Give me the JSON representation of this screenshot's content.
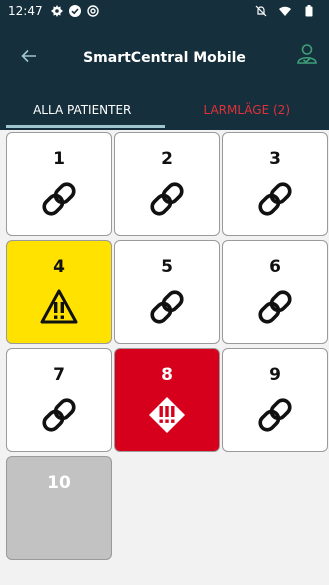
{
  "status_bar": {
    "time": "12:47",
    "left_icons": [
      "settings-icon",
      "check-circle-icon",
      "at-sign-icon"
    ],
    "right_icons": [
      "mute-icon",
      "wifi-icon",
      "battery-icon"
    ]
  },
  "app_bar": {
    "title": "SmartCentral Mobile",
    "back_icon": "arrow-left-icon",
    "profile_icon": "user-badge-icon"
  },
  "tabs": [
    {
      "label": "ALLA PATIENTER",
      "active": true
    },
    {
      "label": "LARMLÄGE (2)",
      "active": false
    }
  ],
  "patients": [
    {
      "number": "1",
      "state": "connected",
      "icon": "link-icon"
    },
    {
      "number": "2",
      "state": "connected",
      "icon": "link-icon"
    },
    {
      "number": "3",
      "state": "connected",
      "icon": "link-icon"
    },
    {
      "number": "4",
      "state": "warning",
      "icon": "warning-triangle-icon"
    },
    {
      "number": "5",
      "state": "connected",
      "icon": "link-icon"
    },
    {
      "number": "6",
      "state": "connected",
      "icon": "link-icon"
    },
    {
      "number": "7",
      "state": "connected",
      "icon": "link-icon"
    },
    {
      "number": "8",
      "state": "critical",
      "icon": "alarm-diamond-icon"
    },
    {
      "number": "9",
      "state": "connected",
      "icon": "link-icon"
    },
    {
      "number": "10",
      "state": "inactive",
      "icon": ""
    }
  ],
  "colors": {
    "header": "#15303c",
    "tab_indicator": "#9fc6cf",
    "alarm_text": "#e0313a",
    "warning": "#ffe200",
    "critical": "#d6001c",
    "inactive": "#c2c2c2"
  }
}
